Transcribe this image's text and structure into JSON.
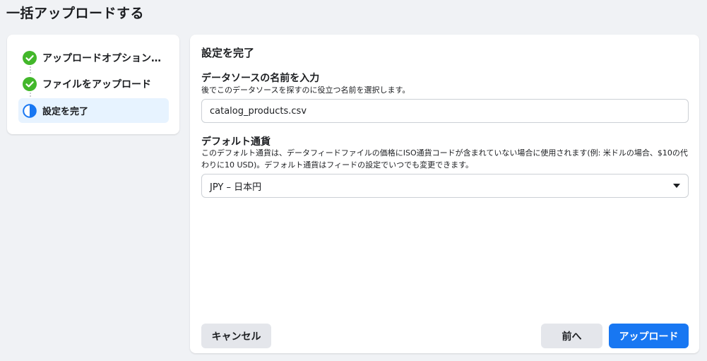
{
  "page": {
    "title": "一括アップロードする"
  },
  "steps": [
    {
      "label": "アップロードオプション…",
      "state": "complete",
      "icon": "check-circle-icon"
    },
    {
      "label": "ファイルをアップロード",
      "state": "complete",
      "icon": "check-circle-icon"
    },
    {
      "label": "設定を完了",
      "state": "in-progress",
      "icon": "half-circle-icon"
    }
  ],
  "main": {
    "section_title": "設定を完了",
    "datasource": {
      "label": "データソースの名前を入力",
      "description": "後でこのデータソースを探すのに役立つ名前を選択します。",
      "value": "catalog_products.csv"
    },
    "currency": {
      "label": "デフォルト通貨",
      "description": "このデフォルト通貨は、データフィードファイルの価格にISO通貨コードが含まれていない場合に使用されます(例: 米ドルの場合、$10の代わりに10 USD)。デフォルト通貨はフィードの設定でいつでも変更できます。",
      "selected": "JPY – 日本円"
    }
  },
  "buttons": {
    "cancel": "キャンセル",
    "back": "前へ",
    "upload": "アップロード"
  },
  "colors": {
    "complete": "#42b72a",
    "accent": "#1877f2",
    "active_bg": "#e7f3ff",
    "background": "#f0f2f5"
  }
}
